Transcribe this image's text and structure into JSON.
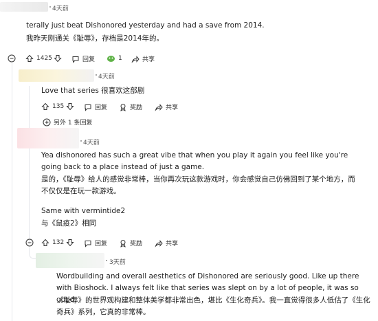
{
  "comments": [
    {
      "time": "4天前",
      "body": "terally just beat Dishonored yesterday and had a save from 2014.",
      "translation": "我昨天刚通关《耻辱》，存档是2014年的。",
      "votes": "1425",
      "reply_label": "回复",
      "award_count": "1",
      "share_label": "共享"
    },
    {
      "time": "4天前",
      "body": "Love that series  很喜欢这部剧",
      "votes": "135",
      "reply_label": "回复",
      "award_label": "奖励",
      "share_label": "共享",
      "more_replies": "另外 1 条回复"
    },
    {
      "time": "4天前",
      "body": "Yea dishonored has such a great vibe that when you play it again you feel like you're going back to a place instead of just a game.",
      "translation": "是的，《耻辱》给人的感觉非常棒，当你再次玩这款游戏时，你会感觉自己仿佛回到了某个地方，而不仅仅是在玩一款游戏。",
      "body2": "Same with vermintide2",
      "translation2": "与《鼠疫2》相同",
      "votes": "132",
      "reply_label": "回复",
      "award_label": "奖励",
      "share_label": "共享"
    },
    {
      "time": "3天前",
      "body": "Wordbuilding and overall aesthetics of Dishonored are seriously good. Like up there with Bioshock. I always felt like that series was slept on by a lot of people, it was so good.",
      "translation": "《耻辱》的世界观构建和整体美学都非常出色，堪比《生化奇兵》。我一直觉得很多人低估了《生化奇兵》系列，它真的非常棒。"
    }
  ]
}
